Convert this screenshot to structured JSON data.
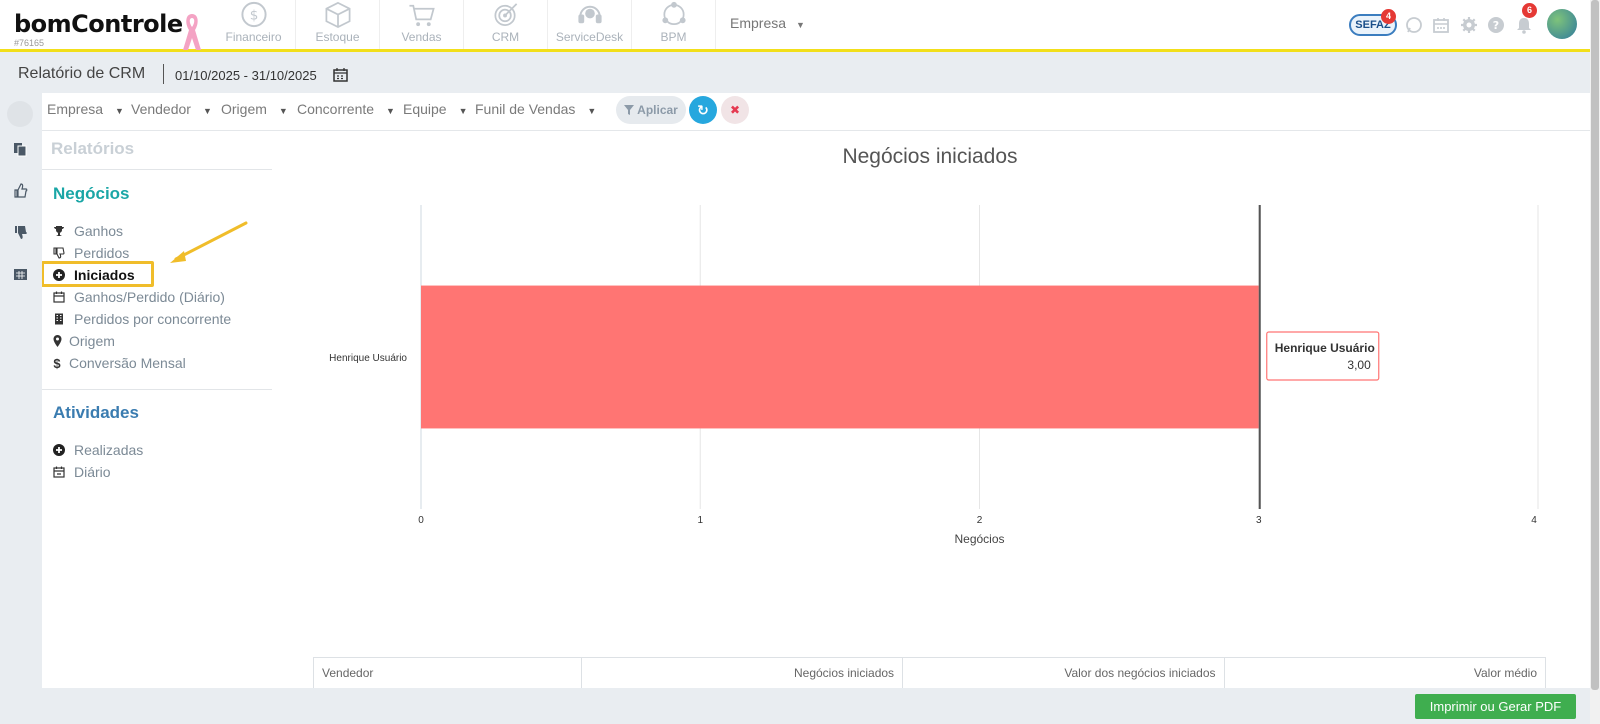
{
  "brand": {
    "logo": "bomControle",
    "account_id": "#76165"
  },
  "modules": [
    {
      "label": "Financeiro",
      "icon": "dollar-coin-icon"
    },
    {
      "label": "Estoque",
      "icon": "box-icon"
    },
    {
      "label": "Vendas",
      "icon": "cart-icon"
    },
    {
      "label": "CRM",
      "icon": "target-icon"
    },
    {
      "label": "ServiceDesk",
      "icon": "headset-icon"
    },
    {
      "label": "BPM",
      "icon": "workflow-icon"
    }
  ],
  "empresa_menu": {
    "label": "Empresa",
    "caret": "▼"
  },
  "top_right": {
    "sefaz_label": "SEFAZ",
    "sefaz_badge": "4",
    "notifications_badge": "6"
  },
  "subheader": {
    "title": "Relatório de CRM",
    "date_range": "01/10/2025 - 31/10/2025"
  },
  "filters": [
    {
      "label": "Empresa",
      "caret": "▼"
    },
    {
      "label": "Vendedor",
      "caret": "▼"
    },
    {
      "label": "Origem",
      "caret": "▼"
    },
    {
      "label": "Concorrente",
      "caret": "▼"
    },
    {
      "label": "Equipe",
      "caret": "▼"
    },
    {
      "label": "Funil de Vendas",
      "caret": "▼"
    }
  ],
  "filter_buttons": {
    "apply": "Aplicar",
    "refresh_glyph": "↻",
    "clear_glyph": "✖"
  },
  "menu": {
    "heading_reports": "Relatórios",
    "heading_deals": "Negócios",
    "deals_items": [
      {
        "label": "Ganhos",
        "icon": "trophy-icon"
      },
      {
        "label": "Perdidos",
        "icon": "thumbs-down-icon"
      },
      {
        "label": "Iniciados",
        "icon": "plus-circle-icon",
        "active": true
      },
      {
        "label": "Ganhos/Perdido (Diário)",
        "icon": "calendar-icon"
      },
      {
        "label": "Perdidos por concorrente",
        "icon": "building-icon"
      },
      {
        "label": "Origem",
        "icon": "map-marker-icon"
      },
      {
        "label": "Conversão Mensal",
        "icon": "dollar-icon"
      }
    ],
    "heading_activities": "Atividades",
    "activity_items": [
      {
        "label": "Realizadas",
        "icon": "plus-circle-icon"
      },
      {
        "label": "Diário",
        "icon": "calendar-minus-icon"
      }
    ]
  },
  "chart_data": {
    "type": "bar",
    "orientation": "horizontal",
    "title": "Negócios iniciados",
    "categories": [
      "Henrique Usuário"
    ],
    "values": [
      3
    ],
    "xlabel": "Negócios",
    "ylabel": "",
    "xlim": [
      0,
      4
    ],
    "xticks": [
      "0",
      "1",
      "2",
      "3",
      "4"
    ],
    "grid": true,
    "bar_color": "#ff7573",
    "tooltip": {
      "title": "Henrique Usuário",
      "value": "3,00"
    }
  },
  "table": {
    "headers": [
      "Vendedor",
      "Negócios iniciados",
      "Valor dos negócios iniciados",
      "Valor médio"
    ]
  },
  "actions": {
    "print_pdf": "Imprimir ou Gerar PDF"
  },
  "colors": {
    "accent_yellow": "#f2df1a",
    "teal": "#1aa6a6",
    "blue": "#3a7cb0",
    "green": "#3fae4f"
  }
}
